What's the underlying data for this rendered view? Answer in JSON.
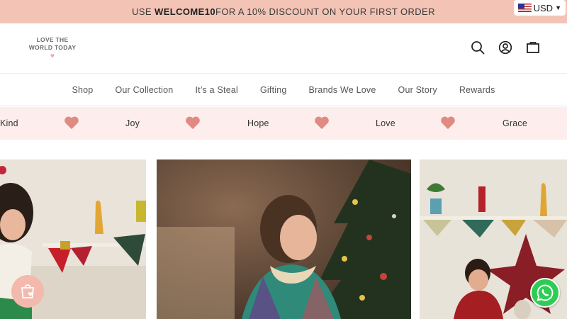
{
  "announcement": {
    "prefix": "USE ",
    "code": "WELCOME10",
    "suffix": " FOR A 10% DISCOUNT ON YOUR FIRST ORDER"
  },
  "currency": {
    "selected": "USD",
    "flag_icon": "us-flag-icon"
  },
  "logo": {
    "line1": "LOVE THE",
    "line2": "WORLD TODAY"
  },
  "header_icons": [
    "search-icon",
    "account-icon",
    "cart-icon"
  ],
  "nav": {
    "items": [
      "Shop",
      "Our Collection",
      "It’s a Steal",
      "Gifting",
      "Brands We Love",
      "Our Story",
      "Rewards"
    ]
  },
  "marquee": {
    "words": [
      "Kind",
      "Joy",
      "Hope",
      "Love",
      "Grace"
    ],
    "heart_color": "#e08a82"
  },
  "colors": {
    "announcement_bg": "#f3c4b5",
    "marquee_bg": "#fdeeed",
    "cart_fab": "#f3b9ad",
    "whatsapp": "#2ecc55"
  },
  "floating": {
    "left_icon": "shopping-bag-heart-icon",
    "right_icon": "whatsapp-icon"
  }
}
